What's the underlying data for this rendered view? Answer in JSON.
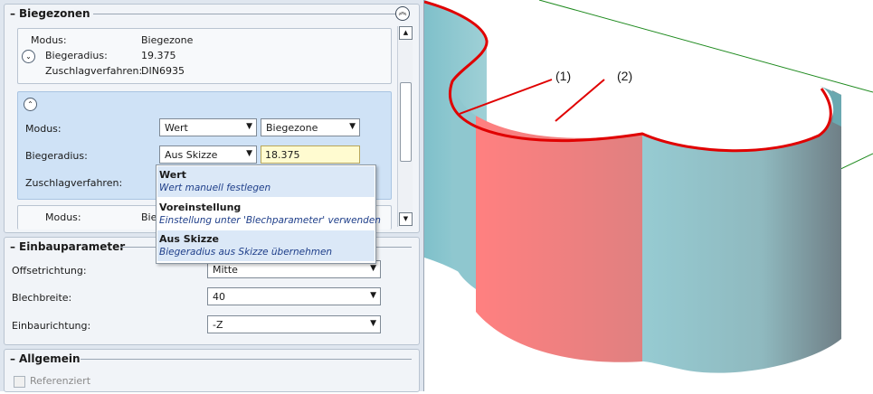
{
  "biegezonen": {
    "title": "Biegezonen",
    "zone1": {
      "mode_label": "Modus:",
      "mode_value": "Biegezone",
      "radius_label": "Biegeradius:",
      "radius_value": "19.375",
      "method_label": "Zuschlagverfahren:",
      "method_value": "DIN6935"
    },
    "zone2": {
      "mode_label": "Modus:",
      "mode_combo1": "Wert",
      "mode_combo2": "Biegezone",
      "radius_label": "Biegeradius:",
      "radius_combo": "Aus Skizze",
      "radius_value": "18.375",
      "method_label": "Zuschlagverfahren:"
    },
    "zone3": {
      "mode_label": "Modus:",
      "mode_value_partial": "Bie"
    }
  },
  "dropdown": {
    "options": [
      {
        "title": "Wert",
        "desc": "Wert manuell festlegen"
      },
      {
        "title": "Voreinstellung",
        "desc": "Einstellung unter 'Blechparameter' verwenden"
      },
      {
        "title": "Aus Skizze",
        "desc": "Biegeradius aus Skizze übernehmen"
      }
    ],
    "highlighted_index": 0,
    "selected_index": 2
  },
  "einbauparameter": {
    "title": "Einbauparameter",
    "offset_label": "Offsetrichtung:",
    "offset_value": "Mitte",
    "width_label": "Blechbreite:",
    "width_value": "40",
    "direction_label": "Einbaurichtung:",
    "direction_value": "-Z"
  },
  "allgemein": {
    "title": "Allgemein",
    "referenced_label": "Referenziert",
    "referenced_checked": false
  },
  "viewport": {
    "label1": "(1)",
    "label2": "(2)",
    "colors": {
      "red_face": "#f08080",
      "teal_face": "#8fc7cf",
      "edge": "#e00000",
      "grid": "#1e8a1e"
    }
  }
}
